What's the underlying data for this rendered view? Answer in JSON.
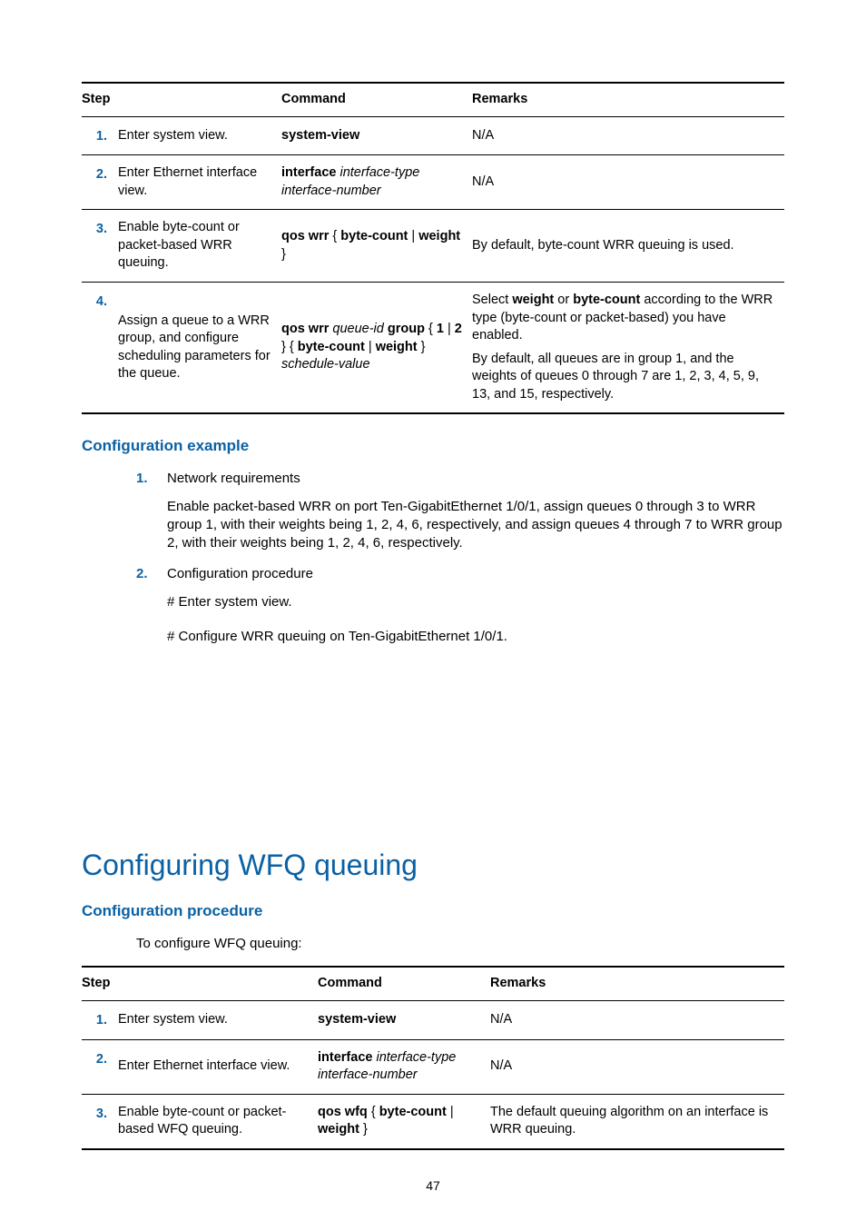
{
  "table1": {
    "headers": {
      "step": "Step",
      "command": "Command",
      "remarks": "Remarks"
    },
    "rows": [
      {
        "num": "1.",
        "step": "Enter system view.",
        "cmd": [
          {
            "t": "system-view",
            "b": true
          }
        ],
        "remarks": [
          [
            {
              "t": "N/A"
            }
          ]
        ]
      },
      {
        "num": "2.",
        "step": "Enter Ethernet interface view.",
        "cmd": [
          {
            "t": "interface ",
            "b": true
          },
          {
            "t": "interface-type interface-number",
            "i": true
          }
        ],
        "remarks": [
          [
            {
              "t": "N/A"
            }
          ]
        ]
      },
      {
        "num": "3.",
        "step": "Enable byte-count or packet-based WRR queuing.",
        "cmd": [
          {
            "t": "qos wrr ",
            "b": true
          },
          {
            "t": "{ "
          },
          {
            "t": "byte-count",
            "b": true
          },
          {
            "t": " | "
          },
          {
            "t": "weight",
            "b": true
          },
          {
            "t": " }"
          }
        ],
        "remarks": [
          [
            {
              "t": "By default, byte-count WRR queuing is used."
            }
          ]
        ]
      },
      {
        "num": "4.",
        "step": "Assign a queue to a WRR group, and configure scheduling parameters for the queue.",
        "cmd": [
          {
            "t": "qos wrr ",
            "b": true
          },
          {
            "t": "queue-id ",
            "i": true
          },
          {
            "t": "group",
            "b": true
          },
          {
            "t": " { "
          },
          {
            "t": "1",
            "b": true
          },
          {
            "t": " | "
          },
          {
            "t": "2",
            "b": true
          },
          {
            "t": " } { "
          },
          {
            "t": "byte-count",
            "b": true
          },
          {
            "t": " | "
          },
          {
            "t": "weight",
            "b": true
          },
          {
            "t": " } "
          },
          {
            "t": "schedule-value",
            "i": true
          }
        ],
        "remarks": [
          [
            {
              "t": "Select "
            },
            {
              "t": "weight",
              "b": true
            },
            {
              "t": " or "
            },
            {
              "t": "byte-count",
              "b": true
            },
            {
              "t": " according to the WRR type (byte-count or packet-based) you have enabled."
            }
          ],
          [
            {
              "t": "By default, all queues are in group 1, and the weights of queues 0 through 7 are 1, 2, 3, 4, 5, 9, 13, and 15, respectively."
            }
          ]
        ]
      }
    ]
  },
  "section_cfg_example": "Configuration example",
  "ex_item1_num": "1.",
  "ex_item1_label": "Network requirements",
  "ex_item1_body": "Enable packet-based WRR on port Ten-GigabitEthernet 1/0/1, assign queues 0 through 3 to WRR group 1, with their weights being 1, 2, 4, 6, respectively, and assign queues 4 through 7 to  WRR group 2, with their weights being 1, 2, 4, 6, respectively.",
  "ex_item2_num": "2.",
  "ex_item2_label": "Configuration procedure",
  "ex_item2_p1": "# Enter system view.",
  "ex_item2_p2": "# Configure WRR queuing on Ten-GigabitEthernet 1/0/1.",
  "h2_wfq": "Configuring WFQ queuing",
  "section_cfg_procedure": "Configuration procedure",
  "wfq_intro": "To configure WFQ queuing:",
  "table2": {
    "headers": {
      "step": "Step",
      "command": "Command",
      "remarks": "Remarks"
    },
    "rows": [
      {
        "num": "1.",
        "step": "Enter system view.",
        "cmd": [
          {
            "t": "system-view",
            "b": true
          }
        ],
        "remarks": [
          [
            {
              "t": "N/A"
            }
          ]
        ]
      },
      {
        "num": "2.",
        "step": "Enter Ethernet interface view.",
        "cmd": [
          {
            "t": "interface ",
            "b": true
          },
          {
            "t": "interface-type interface-number",
            "i": true
          }
        ],
        "remarks": [
          [
            {
              "t": "N/A"
            }
          ]
        ]
      },
      {
        "num": "3.",
        "step": "Enable byte-count or packet-based WFQ queuing.",
        "cmd": [
          {
            "t": "qos wfq ",
            "b": true
          },
          {
            "t": "{ "
          },
          {
            "t": "byte-count",
            "b": true
          },
          {
            "t": " | "
          },
          {
            "t": "weight",
            "b": true
          },
          {
            "t": " }"
          }
        ],
        "remarks": [
          [
            {
              "t": "The default queuing algorithm on an interface is WRR queuing."
            }
          ]
        ]
      }
    ]
  },
  "page_number": "47"
}
